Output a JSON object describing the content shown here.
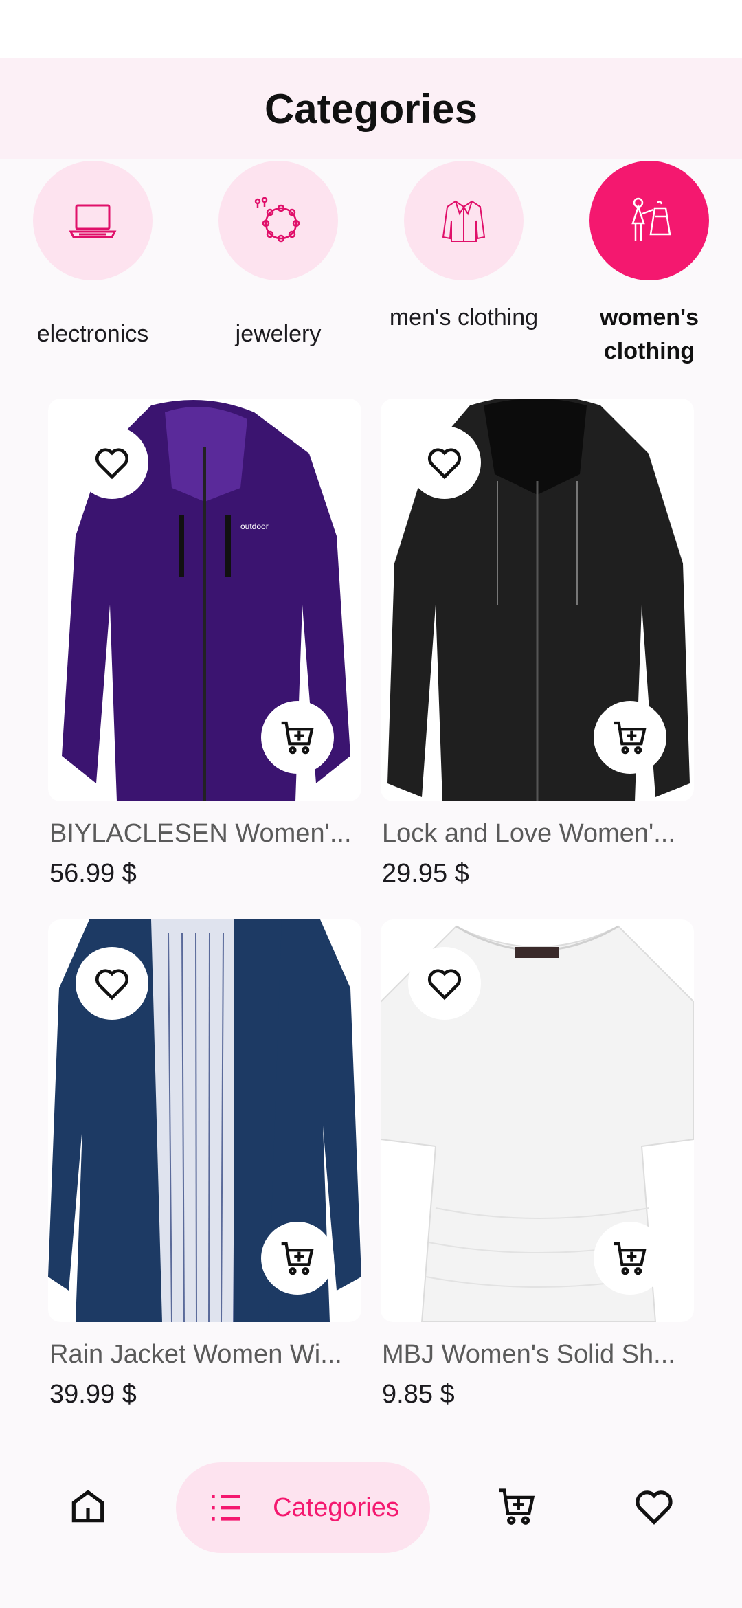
{
  "app_bar": {
    "title": "Categories"
  },
  "categories": [
    {
      "label": "electronics",
      "icon": "laptop-icon",
      "selected": false
    },
    {
      "label": "jewelery",
      "icon": "necklace-icon",
      "selected": false
    },
    {
      "label": "men's clothing",
      "icon": "jacket-icon",
      "selected": false
    },
    {
      "label": "women's clothing",
      "icon": "women-clothing-icon",
      "selected": true
    }
  ],
  "products": [
    {
      "title": "BIYLACLESEN Women'...",
      "price": "56.99 $",
      "image": "purple-hooded-jacket"
    },
    {
      "title": "Lock and Love Women'...",
      "price": "29.95 $",
      "image": "black-leather-jacket"
    },
    {
      "title": "Rain Jacket Women Wi...",
      "price": "39.99 $",
      "image": "navy-rain-jacket"
    },
    {
      "title": "MBJ Women's Solid Sh...",
      "price": "9.85 $",
      "image": "white-top"
    }
  ],
  "bottom_nav": {
    "items": [
      {
        "icon": "home-icon"
      },
      {
        "icon": "list-icon",
        "label": "Categories",
        "selected": true
      },
      {
        "icon": "cart-icon"
      },
      {
        "icon": "heart-icon"
      }
    ]
  },
  "colors": {
    "accent": "#f4186f",
    "accent_light": "#fde3ef",
    "app_bar_bg": "#fcf0f6"
  }
}
